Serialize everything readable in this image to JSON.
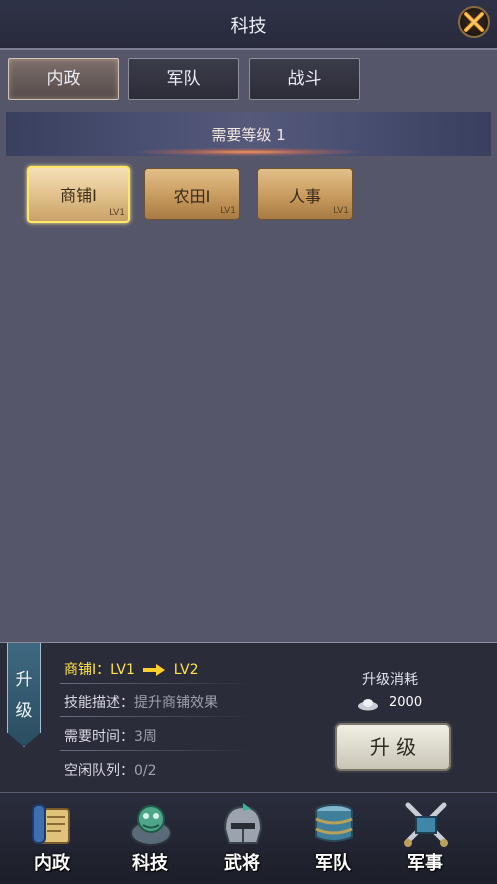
{
  "header": {
    "title": "科技",
    "close_icon": "close-x-icon"
  },
  "tabs": [
    {
      "label": "内政",
      "active": true
    },
    {
      "label": "军队",
      "active": false
    },
    {
      "label": "战斗",
      "active": false
    }
  ],
  "level_banner": {
    "text": "需要等级 1"
  },
  "skills": [
    {
      "name": "商铺I",
      "lv": "LV1",
      "selected": true
    },
    {
      "name": "农田I",
      "lv": "LV1",
      "selected": false
    },
    {
      "name": "人事",
      "lv": "LV1",
      "selected": false
    }
  ],
  "detail": {
    "ribbon": [
      "升",
      "级"
    ],
    "title_name": "商铺I：",
    "from_lv": "LV1",
    "to_lv": "LV2",
    "desc_label": "技能描述：",
    "desc_value": "提升商铺效果",
    "time_label": "需要时间：",
    "time_value": "3周",
    "queue_label": "空闲队列：",
    "queue_value": "0/2",
    "cost_title": "升级消耗",
    "cost_value": "2000",
    "cost_icon": "silver-ingot-icon",
    "upgrade_button": "升 级"
  },
  "nav": [
    {
      "label": "内政",
      "icon": "scroll-icon"
    },
    {
      "label": "科技",
      "icon": "jade-beast-icon"
    },
    {
      "label": "武将",
      "icon": "helmet-icon"
    },
    {
      "label": "军队",
      "icon": "banner-drum-icon"
    },
    {
      "label": "军事",
      "icon": "crossed-swords-icon"
    }
  ],
  "colors": {
    "highlight": "#ffe34a",
    "tab_active": "#7d6f69",
    "skill_gold": "#c79b5e"
  }
}
